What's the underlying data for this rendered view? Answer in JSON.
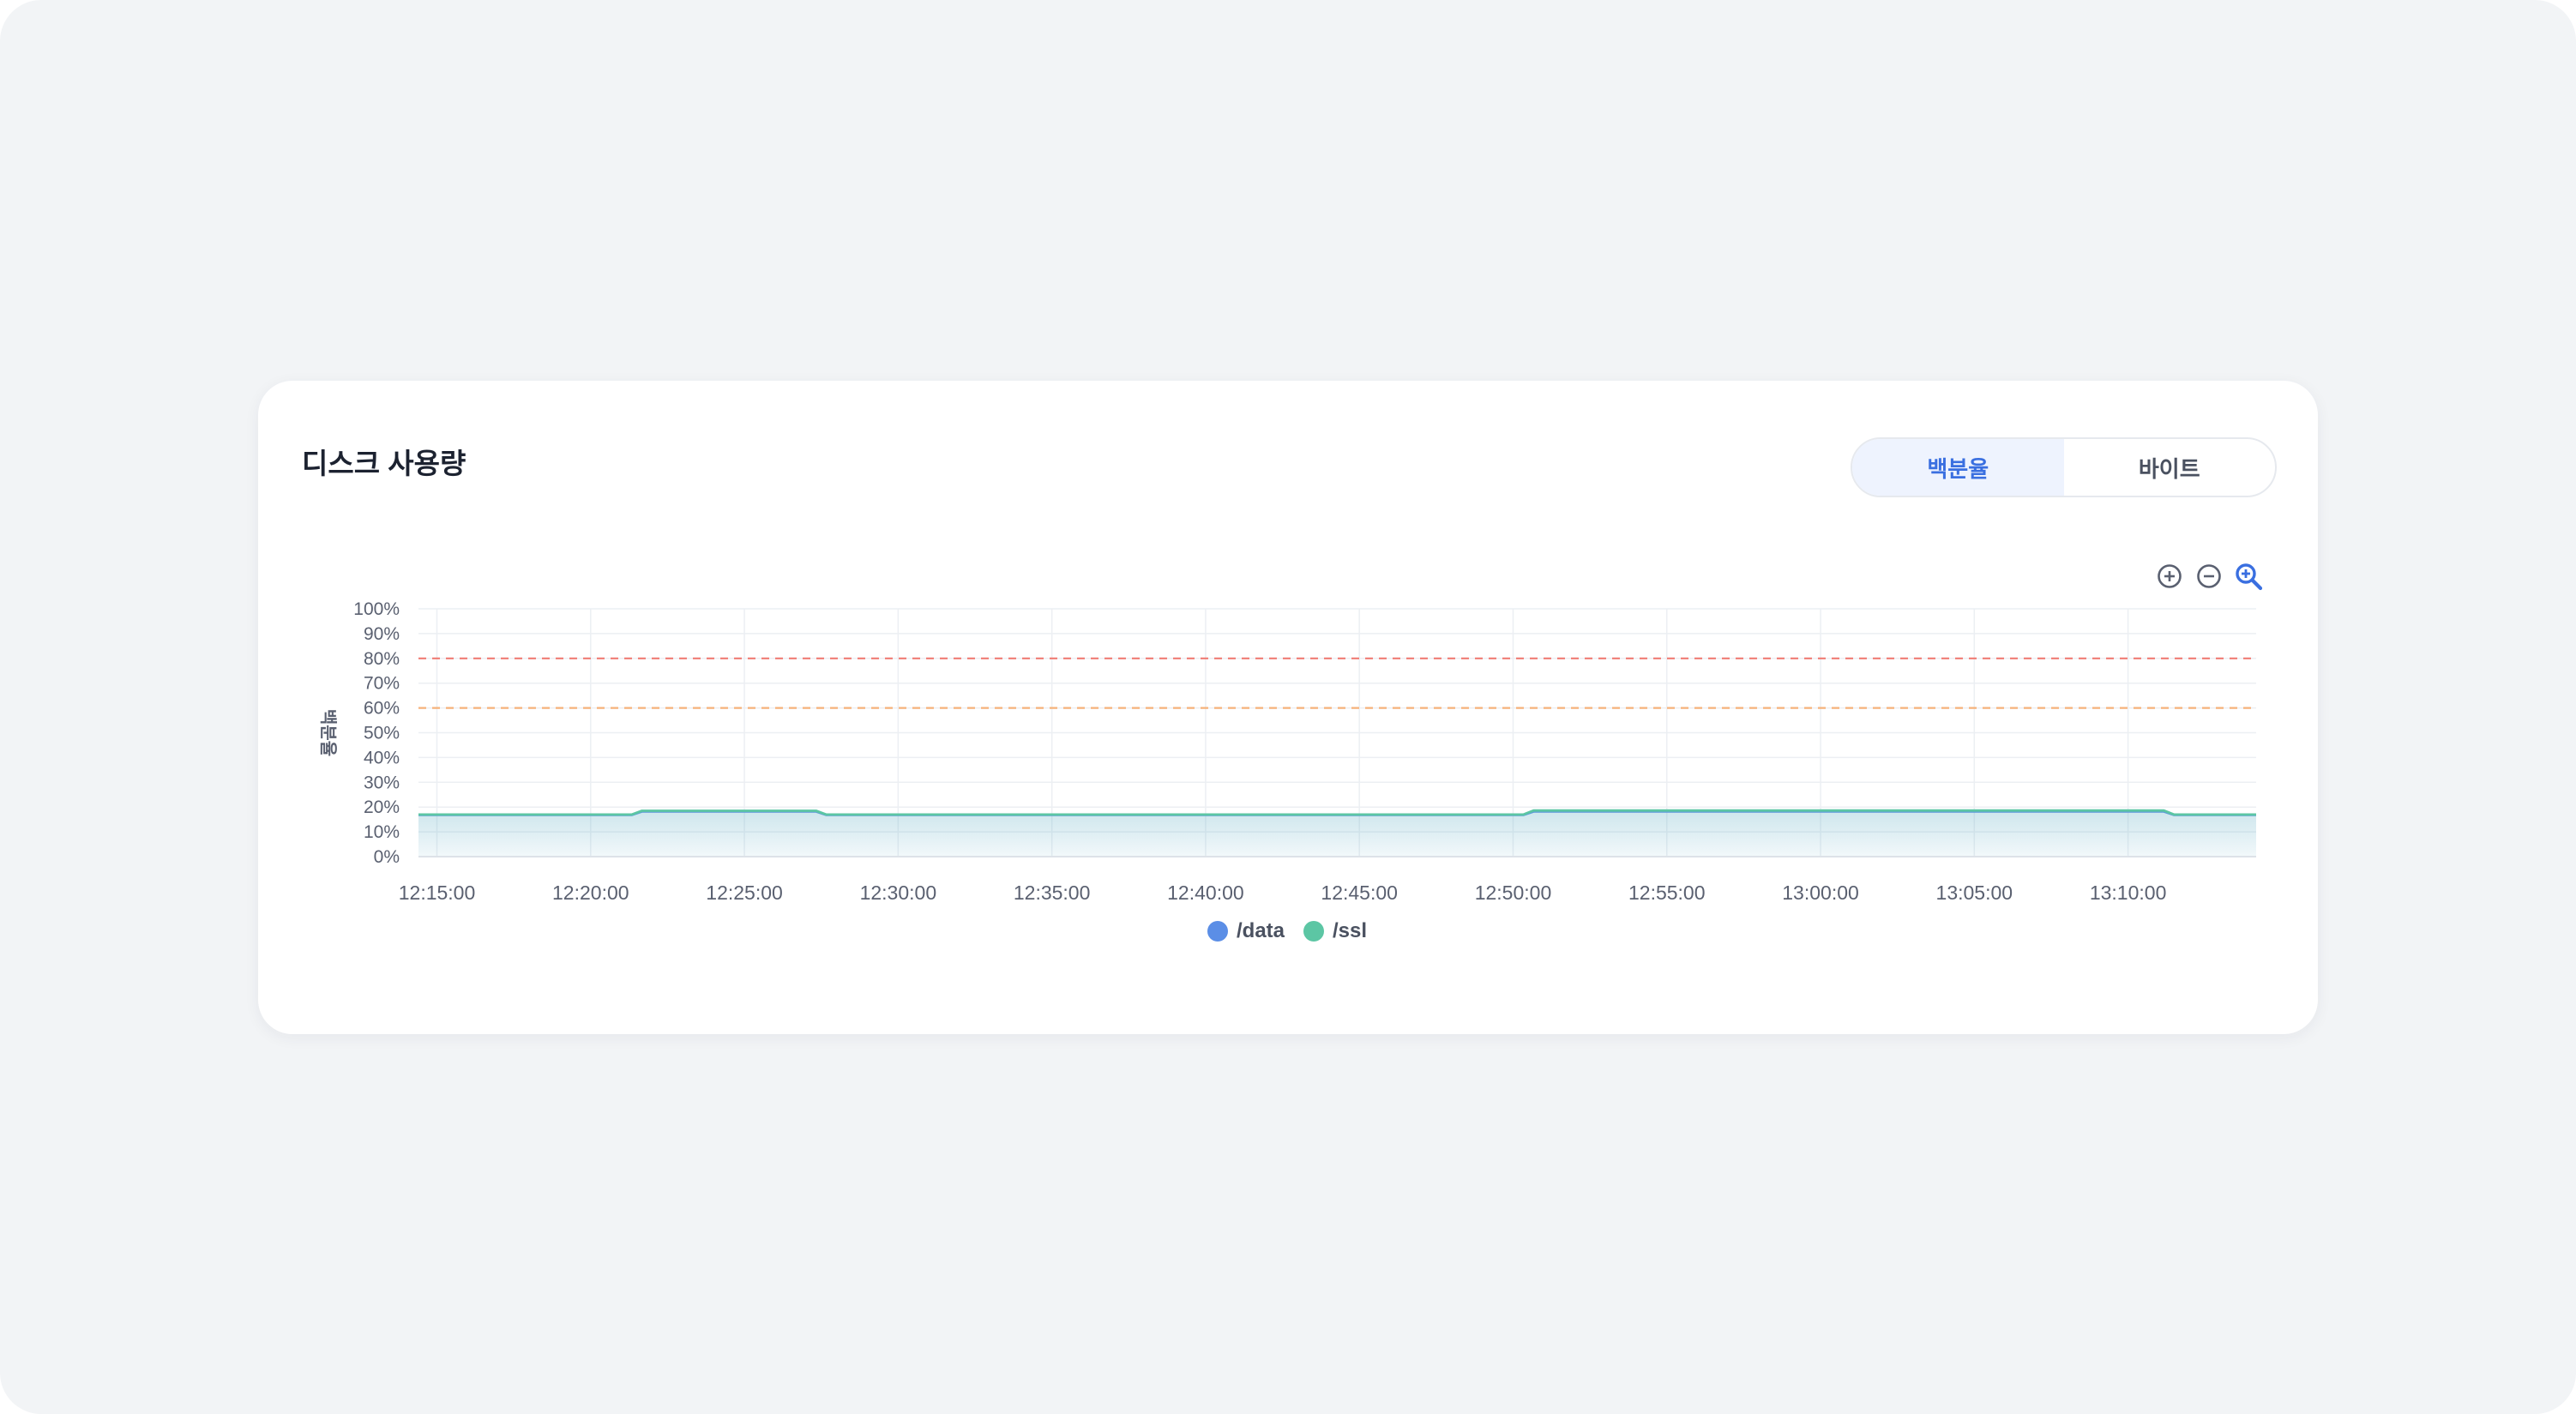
{
  "card": {
    "title": "디스크 사용량",
    "toggle": [
      {
        "label": "백분율",
        "active": true
      },
      {
        "label": "바이트",
        "active": false
      }
    ]
  },
  "toolbar": {
    "icons": [
      "zoom-in-icon",
      "zoom-out-icon",
      "zoom-reset-icon"
    ]
  },
  "colors": {
    "accent": "#3a6fe0",
    "data_series": "#5b8ee6",
    "ssl_series": "#5cc6a4",
    "threshold_critical": "#f07c74",
    "threshold_warning": "#f5b27a",
    "grid": "#eceff3",
    "axis_text": "#5a6070"
  },
  "chart_data": {
    "type": "area",
    "title": "",
    "xlabel": "",
    "ylabel": "백분율",
    "ylim": [
      0,
      100
    ],
    "x_ticks": [
      "12:15:00",
      "12:20:00",
      "12:25:00",
      "12:30:00",
      "12:35:00",
      "12:40:00",
      "12:45:00",
      "12:50:00",
      "12:55:00",
      "13:00:00",
      "13:05:00",
      "13:10:00"
    ],
    "y_ticks": [
      "0%",
      "10%",
      "20%",
      "30%",
      "40%",
      "50%",
      "60%",
      "70%",
      "80%",
      "90%",
      "100%"
    ],
    "x_range": [
      "12:14:24",
      "13:14:10"
    ],
    "grid": true,
    "legend_position": "bottom",
    "thresholds": [
      {
        "value": 80,
        "color": "#f07c74"
      },
      {
        "value": 60,
        "color": "#f5b27a"
      }
    ],
    "series": [
      {
        "name": "/data",
        "color": "#5b8ee6",
        "points": [
          [
            "12:14:24",
            16.8
          ],
          [
            "12:21:20",
            16.8
          ],
          [
            "12:21:40",
            18.2
          ],
          [
            "12:27:20",
            18.2
          ],
          [
            "12:27:40",
            16.8
          ],
          [
            "12:50:20",
            16.8
          ],
          [
            "12:50:40",
            18.2
          ],
          [
            "13:11:10",
            18.2
          ],
          [
            "13:11:30",
            16.8
          ],
          [
            "13:14:10",
            16.8
          ]
        ]
      },
      {
        "name": "/ssl",
        "color": "#5cc6a4",
        "points": [
          [
            "12:14:24",
            17.0
          ],
          [
            "12:21:20",
            17.0
          ],
          [
            "12:21:40",
            18.5
          ],
          [
            "12:27:20",
            18.5
          ],
          [
            "12:27:40",
            17.0
          ],
          [
            "12:50:20",
            17.0
          ],
          [
            "12:50:40",
            18.6
          ],
          [
            "13:11:10",
            18.6
          ],
          [
            "13:11:30",
            17.0
          ],
          [
            "13:14:10",
            17.0
          ]
        ]
      }
    ]
  }
}
